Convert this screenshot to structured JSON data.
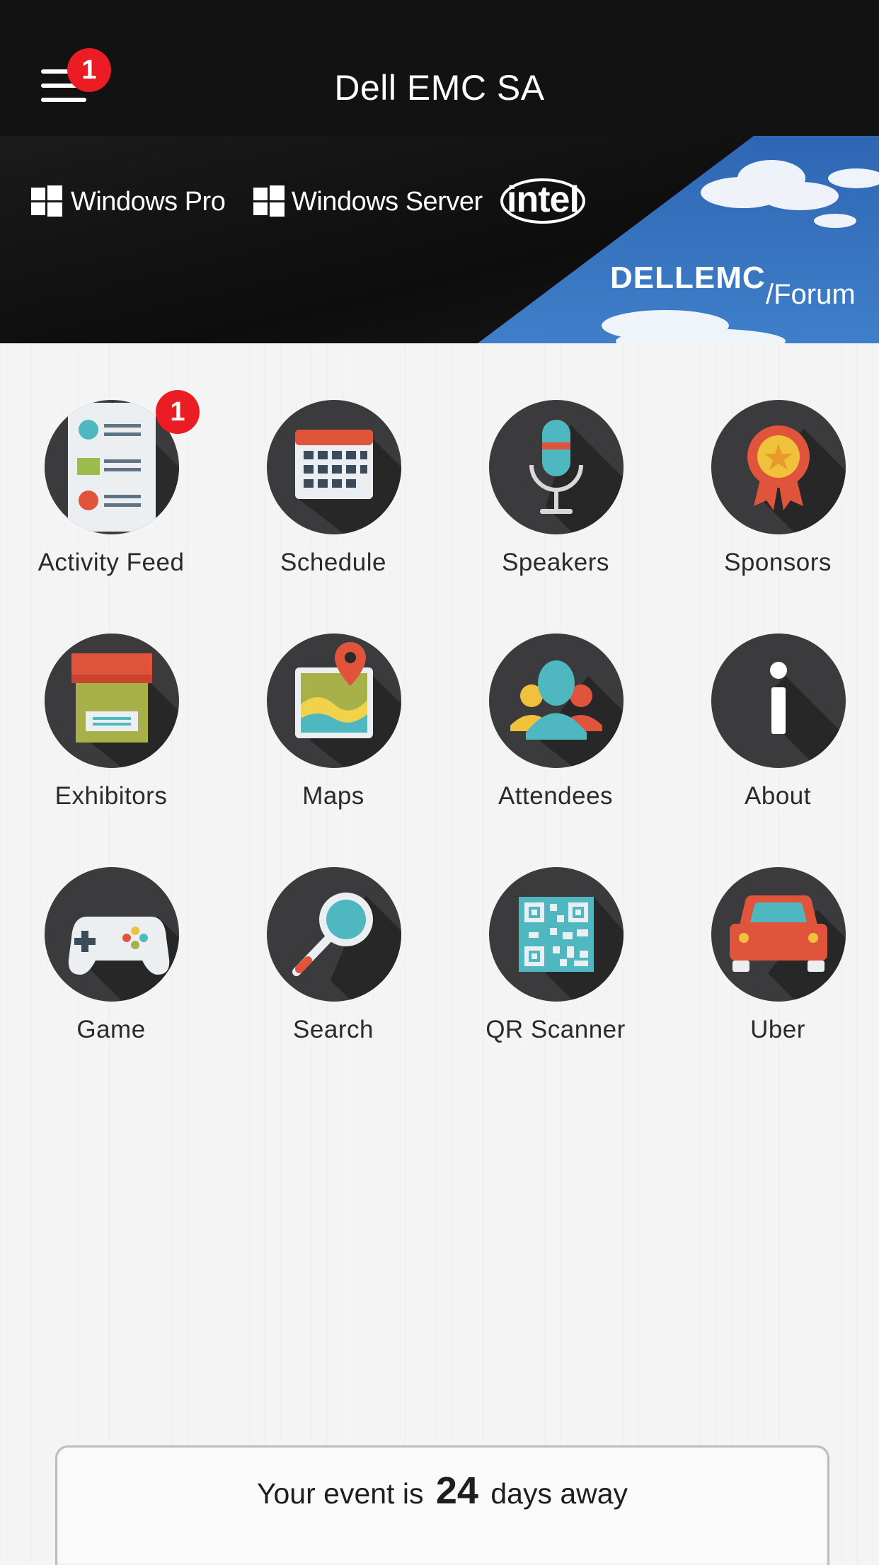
{
  "header": {
    "title": "Dell EMC SA",
    "menu_badge": "1"
  },
  "banner": {
    "brand_1": "Windows Pro",
    "brand_2": "Windows Server",
    "brand_3": "intel",
    "logo_dell": "DELLEMC",
    "logo_forum": "/Forum"
  },
  "tiles": [
    {
      "label": "Activity Feed",
      "icon": "activity-feed-icon",
      "badge": "1"
    },
    {
      "label": "Schedule",
      "icon": "calendar-icon"
    },
    {
      "label": "Speakers",
      "icon": "microphone-icon"
    },
    {
      "label": "Sponsors",
      "icon": "award-ribbon-icon"
    },
    {
      "label": "Exhibitors",
      "icon": "booth-icon"
    },
    {
      "label": "Maps",
      "icon": "map-pin-icon"
    },
    {
      "label": "Attendees",
      "icon": "people-icon"
    },
    {
      "label": "About",
      "icon": "info-icon"
    },
    {
      "label": "Game",
      "icon": "gamepad-icon"
    },
    {
      "label": "Search",
      "icon": "magnifier-icon"
    },
    {
      "label": "QR Scanner",
      "icon": "qr-code-icon"
    },
    {
      "label": "Uber",
      "icon": "car-icon"
    }
  ],
  "countdown": {
    "prefix": "Your event is",
    "days": "24",
    "suffix": "days away"
  },
  "colors": {
    "topbar": "#121212",
    "badge": "#ec1c24",
    "icon_bg": "#3b3a3c",
    "accent_teal": "#4fb7bf"
  }
}
